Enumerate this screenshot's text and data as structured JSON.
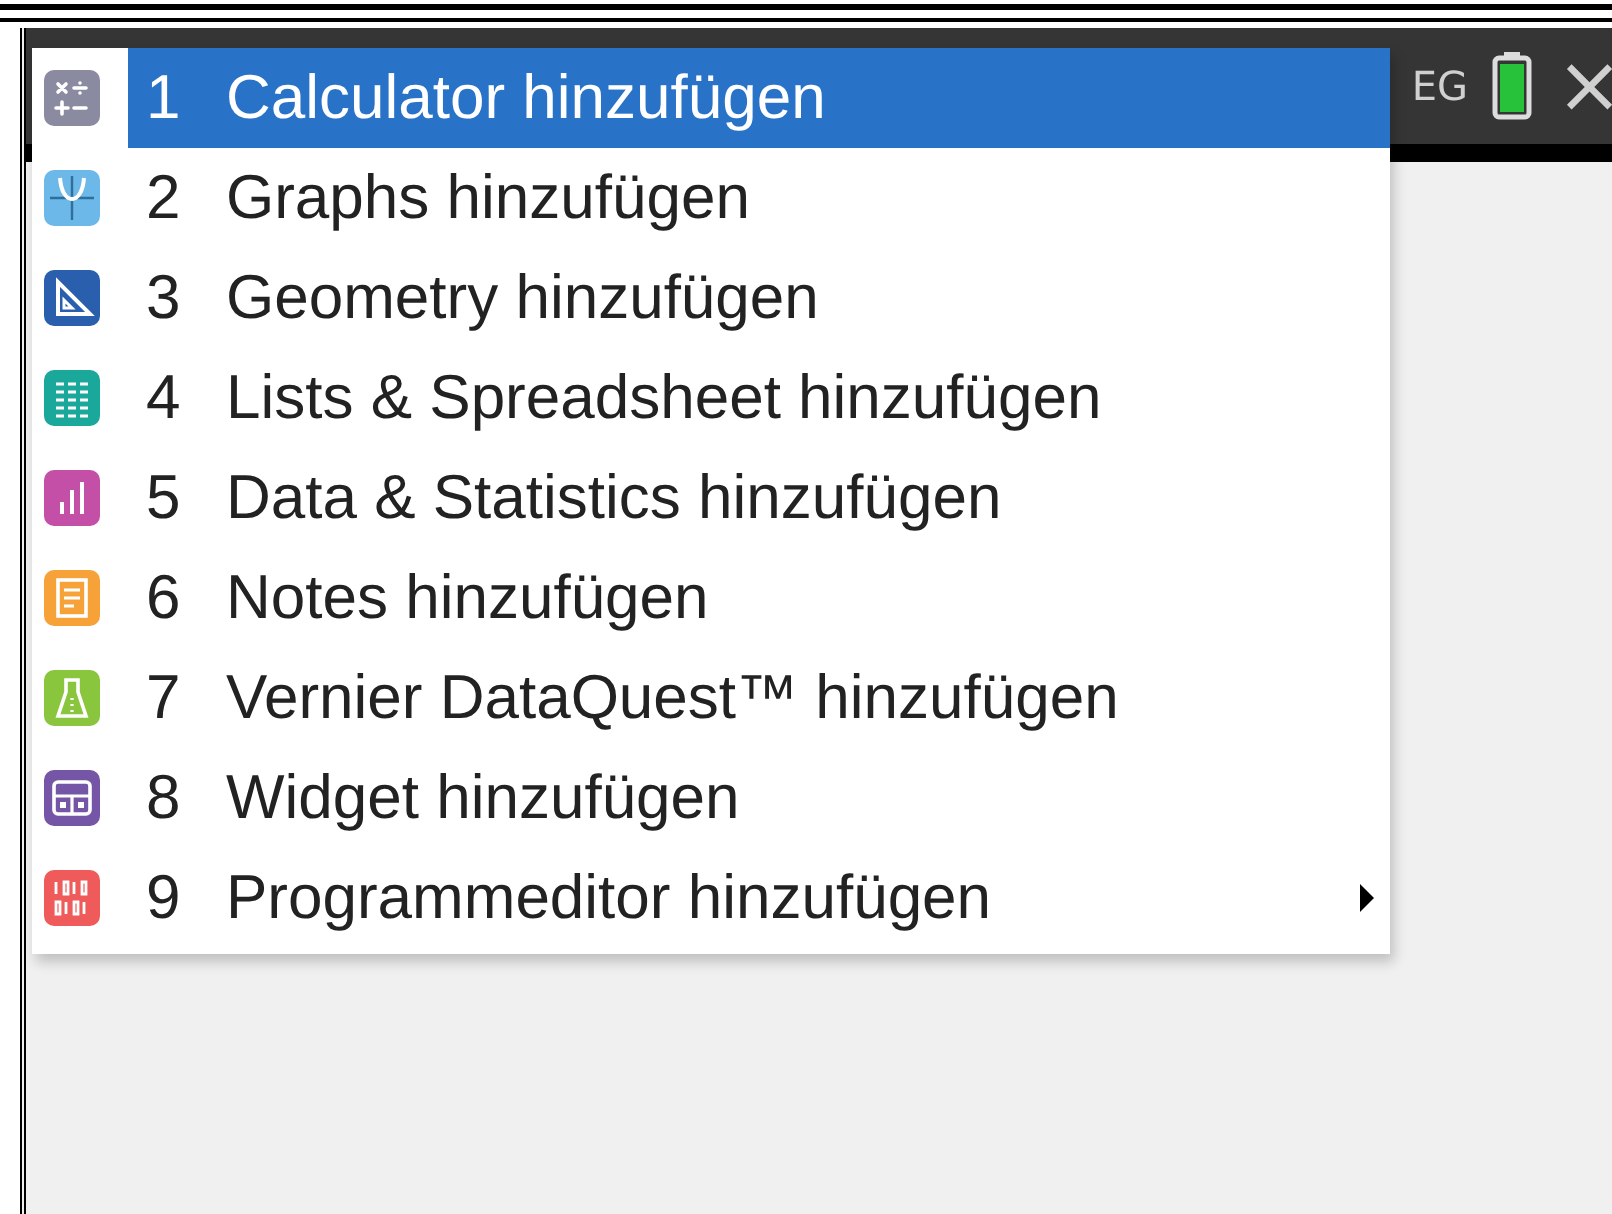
{
  "header": {
    "status_text": "EG",
    "close_label": "×"
  },
  "menu": {
    "items": [
      {
        "kind": "calculator",
        "number": "1",
        "label": "Calculator hinzufügen",
        "selected": true,
        "submenu": false
      },
      {
        "kind": "graphs",
        "number": "2",
        "label": "Graphs hinzufügen",
        "selected": false,
        "submenu": false
      },
      {
        "kind": "geometry",
        "number": "3",
        "label": "Geometry hinzufügen",
        "selected": false,
        "submenu": false
      },
      {
        "kind": "lists",
        "number": "4",
        "label": "Lists & Spreadsheet hinzufügen",
        "selected": false,
        "submenu": false
      },
      {
        "kind": "data",
        "number": "5",
        "label": "Data & Statistics hinzufügen",
        "selected": false,
        "submenu": false
      },
      {
        "kind": "notes",
        "number": "6",
        "label": "Notes hinzufügen",
        "selected": false,
        "submenu": false
      },
      {
        "kind": "vernier",
        "number": "7",
        "label": "Vernier DataQuest™ hinzufügen",
        "selected": false,
        "submenu": false
      },
      {
        "kind": "widget",
        "number": "8",
        "label": "Widget hinzufügen",
        "selected": false,
        "submenu": false
      },
      {
        "kind": "program",
        "number": "9",
        "label": "Programmeditor hinzufügen",
        "selected": false,
        "submenu": true
      }
    ]
  }
}
